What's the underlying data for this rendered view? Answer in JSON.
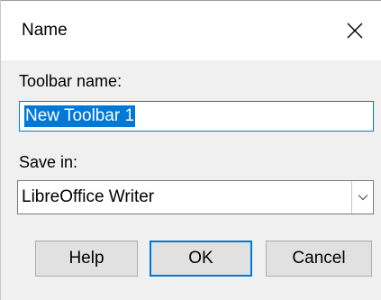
{
  "dialog": {
    "title": "Name",
    "close_icon": "close-icon"
  },
  "form": {
    "toolbar_name_label": "Toolbar name:",
    "toolbar_name_value": "New Toolbar 1",
    "save_in_label": "Save in:",
    "save_in_value": "LibreOffice Writer",
    "dropdown_icon": "chevron-down-icon"
  },
  "buttons": {
    "help": "Help",
    "ok": "OK",
    "cancel": "Cancel"
  },
  "colors": {
    "accent": "#0078d7",
    "dialog_bg": "#f0f0f0",
    "button_bg": "#e1e1e1"
  }
}
